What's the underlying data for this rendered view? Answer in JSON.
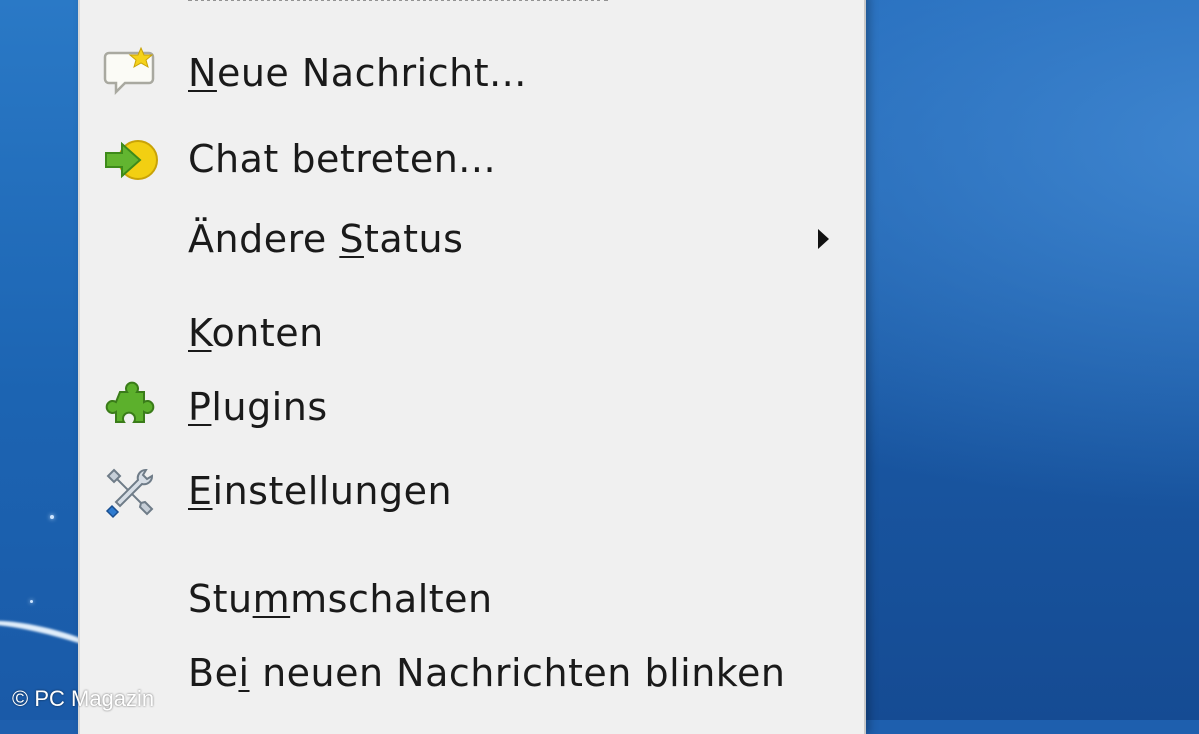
{
  "menu": {
    "items": [
      {
        "label": "Neue Nachricht...",
        "mnemonic_index": 0,
        "icon": "speech-bubble-star-icon",
        "has_submenu": false
      },
      {
        "label": "Chat betreten...",
        "mnemonic_index": -1,
        "icon": "chat-join-arrow-icon",
        "has_submenu": false
      },
      {
        "label": "Ändere Status",
        "mnemonic_index": 7,
        "icon": null,
        "has_submenu": true
      },
      {
        "label": "Konten",
        "mnemonic_index": 0,
        "icon": null,
        "has_submenu": false
      },
      {
        "label": "Plugins",
        "mnemonic_index": 0,
        "icon": "puzzle-piece-icon",
        "has_submenu": false
      },
      {
        "label": "Einstellungen",
        "mnemonic_index": 0,
        "icon": "tools-wrench-screwdriver-icon",
        "has_submenu": false
      },
      {
        "label": "Stummschalten",
        "mnemonic_index": 3,
        "icon": null,
        "has_submenu": false
      },
      {
        "label": "Bei neuen Nachrichten blinken",
        "mnemonic_index": 2,
        "icon": null,
        "has_submenu": false
      }
    ]
  },
  "watermark": "© PC Magazin",
  "colors": {
    "menu_background": "#f0f0f0",
    "desktop_blue": "#1a5aa6",
    "text": "#1a1a1a",
    "plugin_green": "#5cb02c"
  }
}
